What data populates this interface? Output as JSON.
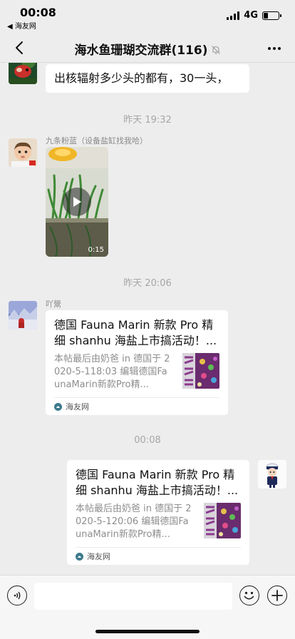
{
  "status_bar": {
    "time": "00:08",
    "back_app": "◀ 海友网",
    "network": "4G",
    "battery_level": 0.3
  },
  "nav": {
    "title": "海水鱼珊瑚交流群(116)"
  },
  "messages": {
    "top_text": "出核辐射多少头的都有，30一头，",
    "time1": "昨天 19:32",
    "video_sender": "九条粉蓝（设备盐缸找我哈）",
    "video_duration": "0:15",
    "time2": "昨天 20:06",
    "link_sender": "吖鬶",
    "link_card": {
      "title": "德国 Fauna Marin 新款 Pro 精细 shanhu 海盐上市搞活动！...",
      "desc": "本帖最后由奶爸 in 德国于 2020-5-118:03 编辑德国FaunaMarin新款Pro精...",
      "source": "海友网"
    },
    "time3": "00:08",
    "my_card": {
      "title": "德国 Fauna Marin 新款 Pro 精细 shanhu 海盐上市搞活动！...",
      "desc": "本帖最后由奶爸 in 德国于 2020-5-120:06 编辑德国FaunaMarin新款Pro精...",
      "source": "海友网"
    }
  },
  "input_bar": {
    "value": ""
  }
}
